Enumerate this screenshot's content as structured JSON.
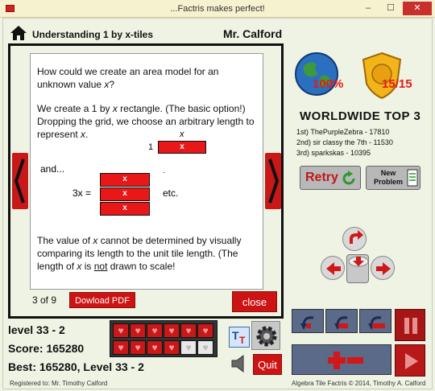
{
  "window": {
    "title": "...Factris makes perfect!",
    "minimize": "–",
    "maximize": "☐",
    "close": "✕"
  },
  "header": {
    "lesson_title": "Understanding 1 by x-tiles",
    "teacher": "Mr. Calford"
  },
  "slide": {
    "para1_a": "How could we create an area model for an unknown value ",
    "para1_var": "x",
    "para1_b": "?",
    "para2_a": "We create a 1 by ",
    "para2_var": "x",
    "para2_b": " rectangle. (The basic option!) Dropping the grid, we choose an arbitrary length to represent ",
    "para2_var2": "x",
    "para2_c": ".",
    "x_label": "x",
    "one_label": "1",
    "tile_label": "x",
    "and_text": "and...",
    "threex": "3x =",
    "etc": "etc.",
    "dot": ".",
    "para3_a": "The value of ",
    "para3_var": "x",
    "para3_b": " cannot be determined by visually comparing its length to the unit tile length.  (The length of ",
    "para3_var2": "x",
    "para3_c": " is ",
    "para3_not": "not",
    "para3_d": " drawn to scale!"
  },
  "panel_footer": {
    "page_count": "3 of 9",
    "pdf_button": "Dowload PDF",
    "close_button": "close"
  },
  "stats": {
    "globe_percent": "100%",
    "badge_value": "15/15"
  },
  "worldwide": {
    "title": "WORLDWIDE TOP 3",
    "entries": [
      "1st) ThePurpleZebra - 17810",
      "2nd) sir classy the 7th - 11530",
      "3rd) sparkskas - 10395"
    ]
  },
  "buttons": {
    "retry": "Retry",
    "new_problem": "New Problem",
    "quit": "Quit"
  },
  "player": {
    "level": "level 33 - 2",
    "score": "Score: 165280",
    "best": "Best: 165280, Level 33 - 2"
  },
  "hearts": {
    "full": 10,
    "total": 12
  },
  "footer": {
    "registered": "Registered to: Mr. Timothy Calford",
    "copyright": "Algebra Tile Factris © 2014, Timothy A. Calford"
  },
  "colors": {
    "accent_red": "#cc1414",
    "tile_red": "#e81818",
    "background": "#eef3e3",
    "control_blue": "#5a6a88"
  },
  "icons": [
    "home-icon",
    "globe-icon",
    "badge-icon",
    "retry-arrow-icon",
    "document-icon",
    "rotate-icon",
    "arrow-left-icon",
    "arrow-right-icon",
    "arrow-down-icon",
    "gear-icon",
    "speaker-icon",
    "pause-icon",
    "play-icon",
    "plus-icon",
    "minus-icon",
    "heart-icon"
  ]
}
